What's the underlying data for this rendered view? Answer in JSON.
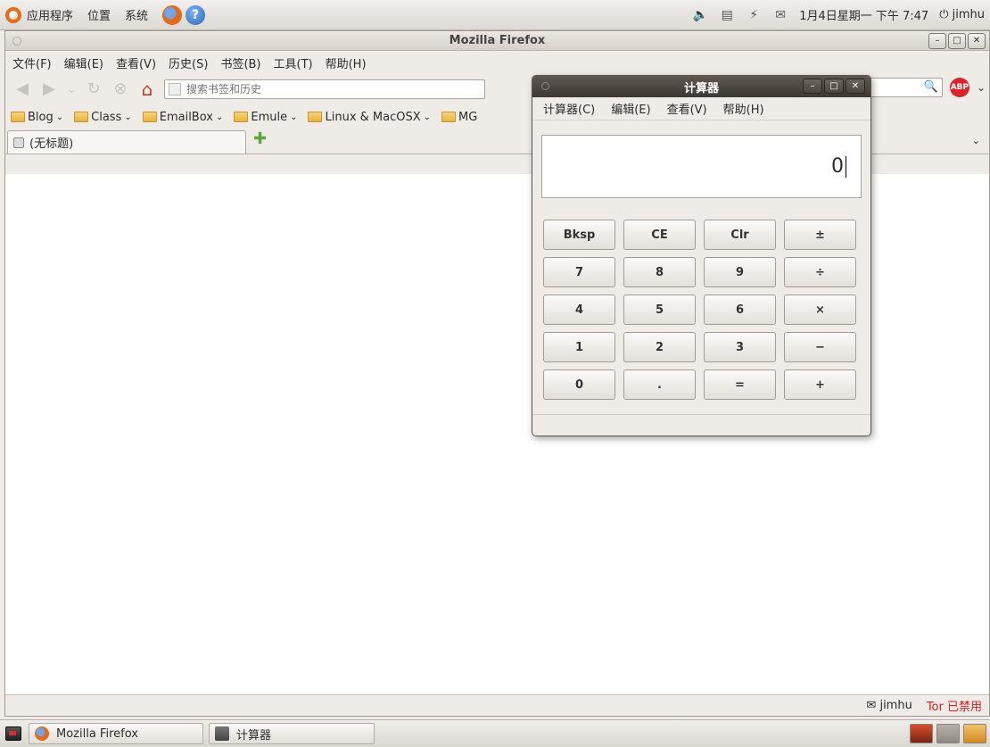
{
  "top_panel": {
    "menus": [
      "应用程序",
      "位置",
      "系统"
    ],
    "clock": "1月4日星期一 下午 7:47",
    "user": "jimhu"
  },
  "firefox": {
    "title": "Mozilla Firefox",
    "menus": [
      "文件(F)",
      "编辑(E)",
      "查看(V)",
      "历史(S)",
      "书签(B)",
      "工具(T)",
      "帮助(H)"
    ],
    "url_placeholder": "搜索书签和历史",
    "bookmarks": [
      "Blog",
      "Class",
      "EmailBox",
      "Emule",
      "Linux & MacOSX",
      "MG"
    ],
    "tab_title": "(无标题)",
    "status_user": "jimhu",
    "tor_status": "Tor 已禁用"
  },
  "calculator": {
    "title": "计算器",
    "menus": [
      "计算器(C)",
      "编辑(E)",
      "查看(V)",
      "帮助(H)"
    ],
    "display": "0",
    "keys": [
      "Bksp",
      "CE",
      "Clr",
      "±",
      "7",
      "8",
      "9",
      "÷",
      "4",
      "5",
      "6",
      "×",
      "1",
      "2",
      "3",
      "−",
      "0",
      ".",
      "=",
      "+"
    ]
  },
  "taskbar": {
    "items": [
      "Mozilla Firefox",
      "计算器"
    ]
  }
}
